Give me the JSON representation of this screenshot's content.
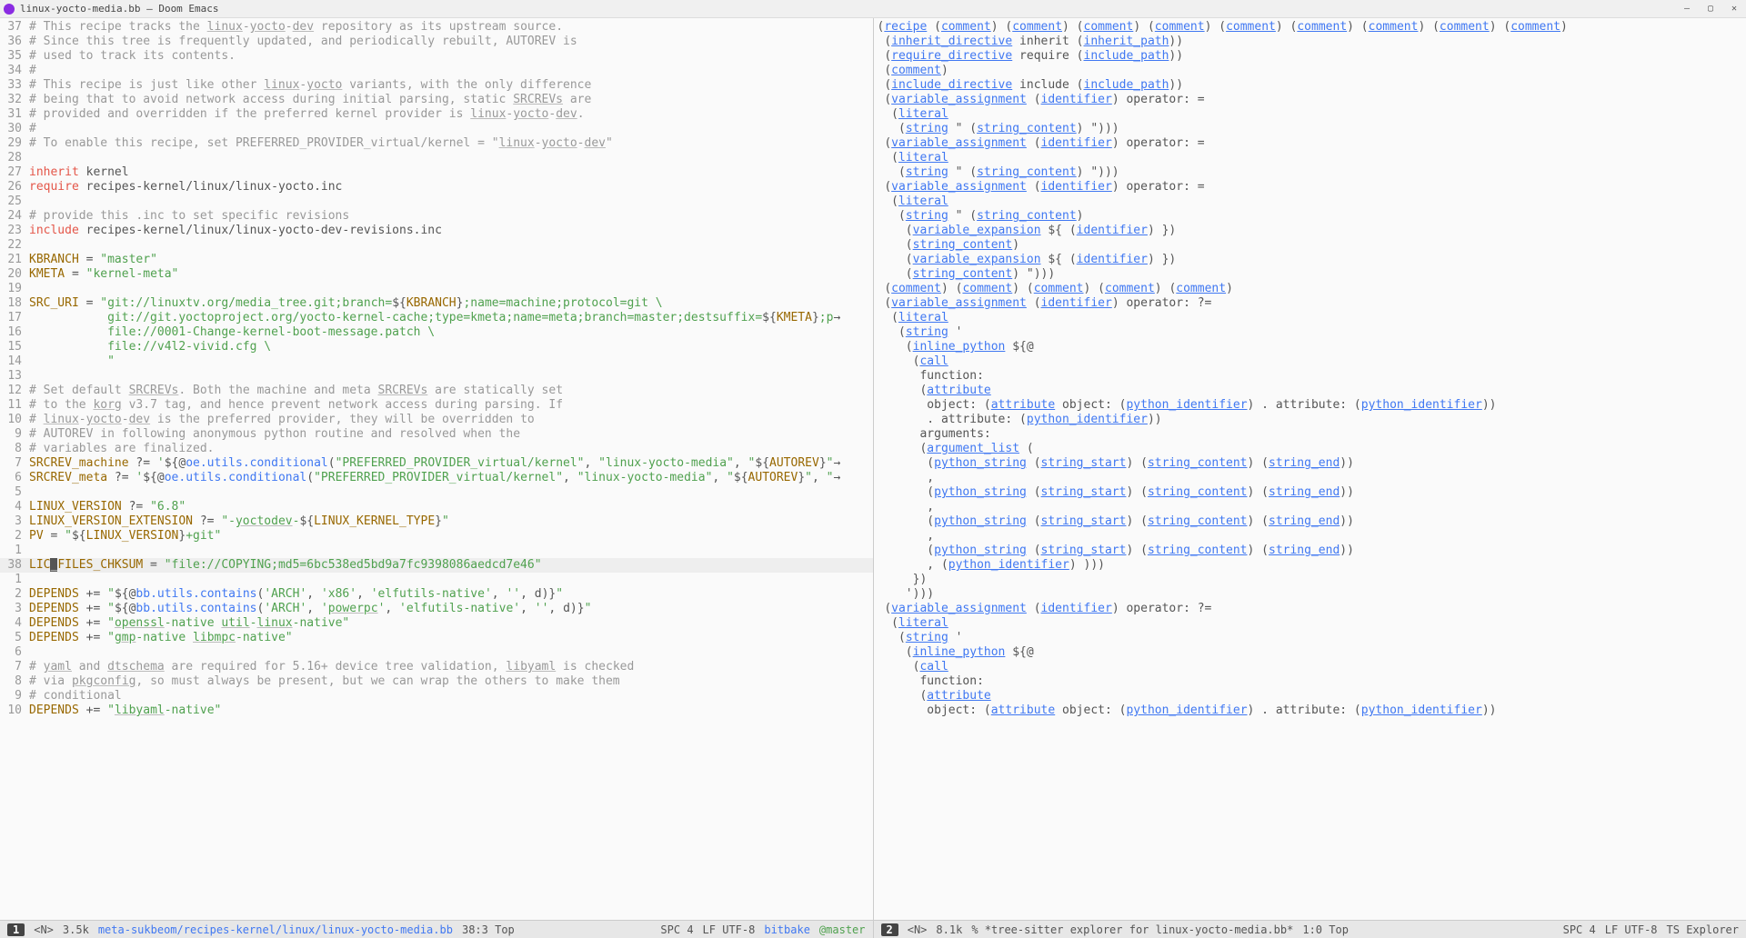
{
  "title": "linux-yocto-media.bb – Doom Emacs",
  "left_pane": {
    "lines": [
      {
        "n": 37,
        "html": "<span class='c'># This recipe tracks the <span class='und'>linux</span>-<span class='und'>yocto</span>-<span class='und'>dev</span> repository as its upstream source.</span>"
      },
      {
        "n": 36,
        "html": "<span class='c'># Since this tree is frequently updated, and periodically rebuilt, AUTOREV is</span>"
      },
      {
        "n": 35,
        "html": "<span class='c'># used to track its contents.</span>"
      },
      {
        "n": 34,
        "html": "<span class='c'>#</span>"
      },
      {
        "n": 33,
        "html": "<span class='c'># This recipe is just like other <span class='und'>linux</span>-<span class='und'>yocto</span> variants, with the only difference</span>"
      },
      {
        "n": 32,
        "html": "<span class='c'># being that to avoid network access during initial parsing, static <span class='und'>SRCREVs</span> are</span>"
      },
      {
        "n": 31,
        "html": "<span class='c'># provided and overridden if the preferred kernel provider is <span class='und'>linux</span>-<span class='und'>yocto</span>-<span class='und'>dev</span>.</span>"
      },
      {
        "n": 30,
        "html": "<span class='c'>#</span>"
      },
      {
        "n": 29,
        "html": "<span class='c'># To enable this recipe, set PREFERRED_PROVIDER_virtual/kernel = \"<span class='und'>linux</span>-<span class='und'>yocto</span>-<span class='und'>dev</span>\"</span>"
      },
      {
        "n": 28,
        "html": ""
      },
      {
        "n": 27,
        "html": "<span class='kw'>inherit</span> kernel"
      },
      {
        "n": 26,
        "html": "<span class='kw'>require</span> recipes-kernel/linux/linux-yocto.inc"
      },
      {
        "n": 25,
        "html": ""
      },
      {
        "n": 24,
        "html": "<span class='c'># provide this .inc to set specific revisions</span>"
      },
      {
        "n": 23,
        "html": "<span class='kw'>include</span> recipes-kernel/linux/linux-yocto-dev-revisions.inc"
      },
      {
        "n": 22,
        "html": ""
      },
      {
        "n": 21,
        "html": "<span class='var'>KBRANCH</span> = <span class='str'>\"master\"</span>"
      },
      {
        "n": 20,
        "html": "<span class='var'>KMETA</span> = <span class='str'>\"kernel-meta\"</span>"
      },
      {
        "n": 19,
        "html": ""
      },
      {
        "n": 18,
        "html": "<span class='var'>SRC_URI</span> = <span class='str'>\"git://linuxtv.org/media_tree.git;branch=</span>${<span class='var'>KBRANCH</span>}<span class='str'>;name=machine;protocol=git \\</span>"
      },
      {
        "n": 17,
        "html": "           <span class='str'>git://git.yoctoproject.org/yocto-kernel-cache;type=kmeta;name=meta;branch=master;destsuffix=</span>${<span class='var'>KMETA</span>}<span class='str'>;p</span>→"
      },
      {
        "n": 16,
        "html": "           <span class='str'>file://0001-Change-kernel-boot-message.patch \\</span>"
      },
      {
        "n": 15,
        "html": "           <span class='str'>file://v4l2-vivid.cfg \\</span>"
      },
      {
        "n": 14,
        "html": "           <span class='str'>\"</span>"
      },
      {
        "n": 13,
        "html": ""
      },
      {
        "n": 12,
        "html": "<span class='c'># Set default <span class='und'>SRCREVs</span>. Both the machine and meta <span class='und'>SRCREVs</span> are statically set</span>"
      },
      {
        "n": 11,
        "html": "<span class='c'># to the <span class='und'>korg</span> v3.7 tag, and hence prevent network access during parsing. If</span>"
      },
      {
        "n": 10,
        "html": "<span class='c'># <span class='und'>linux</span>-<span class='und'>yocto</span>-<span class='und'>dev</span> is the preferred provider, they will be overridden to</span>"
      },
      {
        "n": 9,
        "html": "<span class='c'># AUTOREV in following anonymous python routine and resolved when the</span>"
      },
      {
        "n": 8,
        "html": "<span class='c'># variables are finalized.</span>"
      },
      {
        "n": 7,
        "html": "<span class='var'>SRCREV_machine</span> ?= <span class='str'>'</span>${@<span class='fn'>oe.utils.conditional</span>(<span class='str'>\"PREFERRED_PROVIDER_virtual/kernel\"</span>, <span class='str'>\"linux-yocto-media\"</span>, <span class='str'>\"</span>${<span class='var'>AUTOREV</span>}<span class='str'>\"</span>→"
      },
      {
        "n": 6,
        "html": "<span class='var'>SRCREV_meta</span> ?= <span class='str'>'</span>${@<span class='fn'>oe.utils.conditional</span>(<span class='str'>\"PREFERRED_PROVIDER_virtual/kernel\"</span>, <span class='str'>\"linux-yocto-media\"</span>, <span class='str'>\"</span>${<span class='var'>AUTOREV</span>}<span class='str'>\"</span>, <span class='str'>\"</span>→"
      },
      {
        "n": 5,
        "html": ""
      },
      {
        "n": 4,
        "html": "<span class='var'>LINUX_VERSION</span> ?= <span class='str'>\"6.8\"</span>"
      },
      {
        "n": 3,
        "html": "<span class='var'>LINUX_VERSION_EXTENSION</span> ?= <span class='str'>\"-<span class='und'>yoctodev</span>-</span>${<span class='var'>LINUX_KERNEL_TYPE</span>}<span class='str'>\"</span>"
      },
      {
        "n": 2,
        "html": "<span class='var'>PV</span> = <span class='str'>\"</span>${<span class='var'>LINUX_VERSION</span>}<span class='str'>+git\"</span>"
      },
      {
        "n": 1,
        "html": ""
      },
      {
        "n": 38,
        "html": "<span class='var'>LIC<span class='cursor-block'>_</span>FILES_CHKSUM</span> = <span class='str'>\"file://COPYING;md5=6bc538ed5bd9a7fc9398086aedcd7e46\"</span>",
        "current": true
      },
      {
        "n": 1,
        "html": ""
      },
      {
        "n": 2,
        "html": "<span class='var'>DEPENDS</span> += <span class='str'>\"</span>${@<span class='fn'>bb.utils.contains</span>(<span class='str'>'ARCH'</span>, <span class='str'>'x86'</span>, <span class='str'>'elfutils-native'</span>, <span class='str'>''</span>, d)}<span class='str'>\"</span>"
      },
      {
        "n": 3,
        "html": "<span class='var'>DEPENDS</span> += <span class='str'>\"</span>${@<span class='fn'>bb.utils.contains</span>(<span class='str'>'ARCH'</span>, <span class='str'>'<span class='und'>powerpc</span>'</span>, <span class='str'>'elfutils-native'</span>, <span class='str'>''</span>, d)}<span class='str'>\"</span>"
      },
      {
        "n": 4,
        "html": "<span class='var'>DEPENDS</span> += <span class='str'>\"<span class='und'>openssl</span>-native <span class='und'>util</span>-<span class='und'>linux</span>-native\"</span>"
      },
      {
        "n": 5,
        "html": "<span class='var'>DEPENDS</span> += <span class='str'>\"<span class='und'>gmp</span>-native <span class='und'>libmpc</span>-native\"</span>"
      },
      {
        "n": 6,
        "html": ""
      },
      {
        "n": 7,
        "html": "<span class='c'># <span class='und'>yaml</span> and <span class='und'>dtschema</span> are required for 5.16+ device tree validation, <span class='und'>libyaml</span> is checked</span>"
      },
      {
        "n": 8,
        "html": "<span class='c'># via <span class='und'>pkgconfig</span>, so must always be present, but we can wrap the others to make them</span>"
      },
      {
        "n": 9,
        "html": "<span class='c'># conditional</span>"
      },
      {
        "n": 10,
        "html": "<span class='var'>DEPENDS</span> += <span class='str'>\"<span class='und'>libyaml</span>-native\"</span>"
      }
    ]
  },
  "right_pane": {
    "lines": [
      "(<span class='link'>recipe</span> (<span class='link'>comment</span>) (<span class='link'>comment</span>) (<span class='link'>comment</span>) (<span class='link'>comment</span>) (<span class='link'>comment</span>) (<span class='link'>comment</span>) (<span class='link'>comment</span>) (<span class='link'>comment</span>) (<span class='link'>comment</span>)",
      " (<span class='link'>inherit_directive</span> inherit (<span class='link'>inherit_path</span>))",
      " (<span class='link'>require_directive</span> require (<span class='link'>include_path</span>))",
      " (<span class='link'>comment</span>)",
      " (<span class='link'>include_directive</span> include (<span class='link'>include_path</span>))",
      " (<span class='link'>variable_assignment</span> (<span class='link'>identifier</span>) operator: =",
      "  (<span class='link'>literal</span>",
      "   (<span class='link'>string</span> \" (<span class='link'>string_content</span>) \")))",
      " (<span class='link'>variable_assignment</span> (<span class='link'>identifier</span>) operator: =",
      "  (<span class='link'>literal</span>",
      "   (<span class='link'>string</span> \" (<span class='link'>string_content</span>) \")))",
      " (<span class='link'>variable_assignment</span> (<span class='link'>identifier</span>) operator: =",
      "  (<span class='link'>literal</span>",
      "   (<span class='link'>string</span> \" (<span class='link'>string_content</span>)",
      "    (<span class='link'>variable_expansion</span> ${ (<span class='link'>identifier</span>) })",
      "    (<span class='link'>string_content</span>)",
      "    (<span class='link'>variable_expansion</span> ${ (<span class='link'>identifier</span>) })",
      "    (<span class='link'>string_content</span>) \")))",
      " (<span class='link'>comment</span>) (<span class='link'>comment</span>) (<span class='link'>comment</span>) (<span class='link'>comment</span>) (<span class='link'>comment</span>)",
      " (<span class='link'>variable_assignment</span> (<span class='link'>identifier</span>) operator: ?=",
      "  (<span class='link'>literal</span>",
      "   (<span class='link'>string</span> '",
      "    (<span class='link'>inline_python</span> ${@",
      "     (<span class='link'>call</span>",
      "      function:",
      "      (<span class='link'>attribute</span>",
      "       object: (<span class='link'>attribute</span> object: (<span class='link'>python_identifier</span>) . attribute: (<span class='link'>python_identifier</span>))",
      "       . attribute: (<span class='link'>python_identifier</span>))",
      "      arguments:",
      "      (<span class='link'>argument_list</span> (",
      "       (<span class='link'>python_string</span> (<span class='link'>string_start</span>) (<span class='link'>string_content</span>) (<span class='link'>string_end</span>))",
      "       ,",
      "       (<span class='link'>python_string</span> (<span class='link'>string_start</span>) (<span class='link'>string_content</span>) (<span class='link'>string_end</span>))",
      "       ,",
      "       (<span class='link'>python_string</span> (<span class='link'>string_start</span>) (<span class='link'>string_content</span>) (<span class='link'>string_end</span>))",
      "       ,",
      "       (<span class='link'>python_string</span> (<span class='link'>string_start</span>) (<span class='link'>string_content</span>) (<span class='link'>string_end</span>))",
      "       , (<span class='link'>python_identifier</span>) )))",
      "     })",
      "    ')))",
      " (<span class='link'>variable_assignment</span> (<span class='link'>identifier</span>) operator: ?=",
      "  (<span class='link'>literal</span>",
      "   (<span class='link'>string</span> '",
      "    (<span class='link'>inline_python</span> ${@",
      "     (<span class='link'>call</span>",
      "      function:",
      "      (<span class='link'>attribute</span>",
      "       object: (<span class='link'>attribute</span> object: (<span class='link'>python_identifier</span>) . attribute: (<span class='link'>python_identifier</span>))"
    ]
  },
  "statusbar": {
    "left": {
      "num": "1",
      "mode": "<N>",
      "size": "3.5k",
      "path": "meta-sukbeom/recipes-kernel/linux/linux-yocto-media.bb",
      "pos": "38:3 Top",
      "indent": "SPC 4",
      "enc": "LF UTF-8",
      "lang": "bitbake",
      "branch": "@master"
    },
    "right": {
      "num": "2",
      "mode": "<N>",
      "size": "8.1k",
      "buf": "% *tree-sitter explorer for linux-yocto-media.bb*",
      "pos": "1:0 Top",
      "indent": "SPC 4",
      "enc": "LF UTF-8",
      "lang": "TS Explorer"
    }
  }
}
